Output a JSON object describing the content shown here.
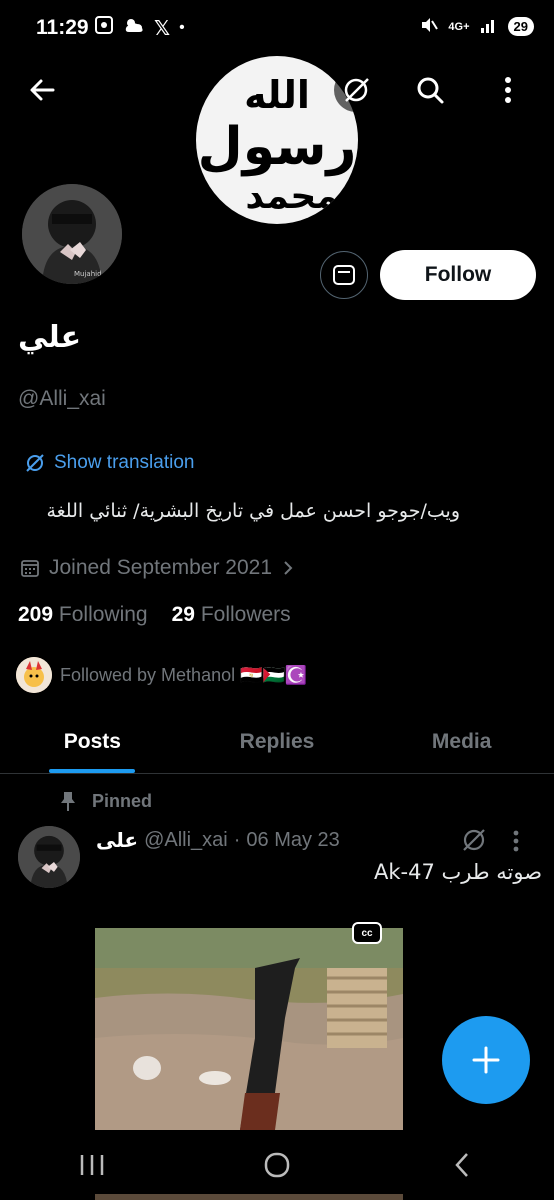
{
  "status_bar": {
    "time": "11:29",
    "left_icons": [
      "screenshot-icon",
      "weather-icon",
      "x-app-icon",
      "dot-icon"
    ],
    "network": "4G+",
    "battery": "29"
  },
  "banner": {
    "logo_text_top": "الله",
    "logo_text_mid": "رسول",
    "logo_text_bottom": "محمد"
  },
  "profile": {
    "display_name": "علي",
    "handle": "@Alli_xai",
    "show_translation_label": "Show translation",
    "bio": "ويب/جوجو احسن عمل في تاريخ البشرية/ ثنائي اللغة",
    "joined": "Joined September 2021",
    "following_count": "209",
    "following_label": "Following",
    "followers_count": "29",
    "followers_label": "Followers",
    "followed_by_text": "Followed by Methanol 🇪🇬🇵🇸☪️",
    "follow_button": "Follow"
  },
  "tabs": [
    {
      "label": "Posts",
      "active": true
    },
    {
      "label": "Replies",
      "active": false
    },
    {
      "label": "Media",
      "active": false
    }
  ],
  "post": {
    "pinned_label": "Pinned",
    "author_name": "على",
    "author_handle": "@Alli_xai",
    "separator": "·",
    "date": "06 May 23",
    "text": "Ak-47 صوته طرب",
    "cc_label": "cc"
  },
  "colors": {
    "accent": "#1d9bf0",
    "link": "#4a9eec",
    "muted": "#71767b",
    "background": "#000000"
  }
}
